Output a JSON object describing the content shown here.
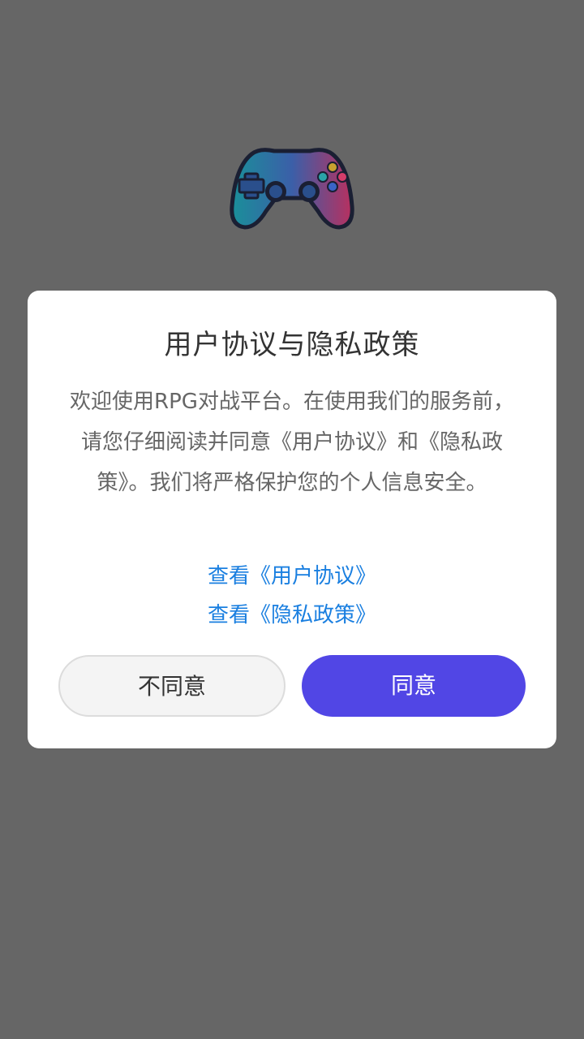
{
  "logo": {
    "icon": "gamepad-icon"
  },
  "dialog": {
    "title": "用户协议与隐私政策",
    "message": "欢迎使用RPG对战平台。在使用我们的服务前，请您仔细阅读并同意《用户协议》和《隐私政策》。我们将严格保护您的个人信息安全。",
    "link_user_agreement": "查看《用户协议》",
    "link_privacy_policy": "查看《隐私政策》",
    "disagree_label": "不同意",
    "agree_label": "同意"
  },
  "colors": {
    "background": "#666666",
    "accent": "#5146e5",
    "link": "#1a7fe0"
  }
}
